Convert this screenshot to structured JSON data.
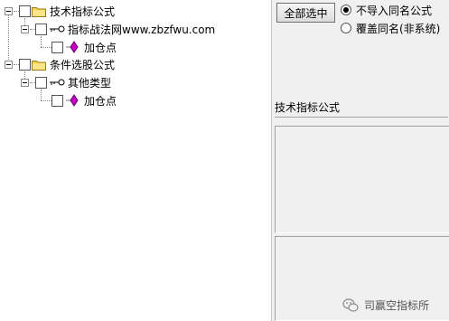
{
  "tree": {
    "nodes": [
      {
        "label": "技术指标公式",
        "type": "folder",
        "depth": 0
      },
      {
        "label": "指标战法网www.zbzfwu.com",
        "type": "key",
        "depth": 1
      },
      {
        "label": "加仓点",
        "type": "item",
        "depth": 2
      },
      {
        "label": "条件选股公式",
        "type": "folder",
        "depth": 0
      },
      {
        "label": "其他类型",
        "type": "key",
        "depth": 1
      },
      {
        "label": "加仓点",
        "type": "item",
        "depth": 2
      }
    ]
  },
  "right_panel": {
    "select_all_button": "全部选中",
    "radio_options": [
      {
        "label": "不导入同名公式",
        "checked": true
      },
      {
        "label": "覆盖同名(非系统)",
        "checked": false
      }
    ],
    "group_label": "技术指标公式"
  },
  "watermark": {
    "text": "司赢空指标所",
    "icon": "wechat-icon"
  },
  "colors": {
    "folder": "#f5d64a",
    "diamond": "#c800c8",
    "panel_bg": "#f0f0f0"
  }
}
